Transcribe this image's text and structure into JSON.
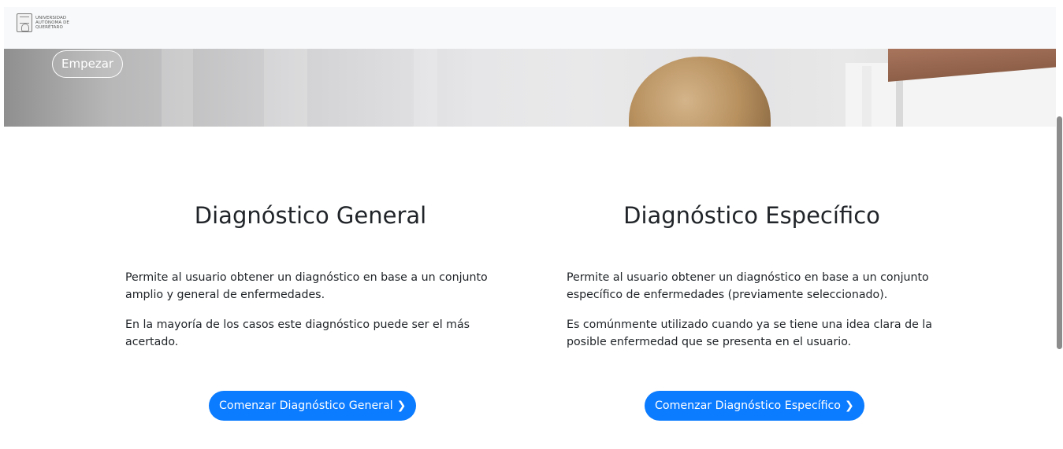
{
  "header": {
    "logo_lines": [
      "UNIVERSIDAD",
      "AUTÓNOMA DE",
      "QUERÉTARO"
    ]
  },
  "hero": {
    "start_label": "Empezar"
  },
  "general": {
    "title": "Diagnóstico General",
    "p1": "Permite al usuario obtener un diagnóstico en base a un conjunto amplio y general de enfermedades.",
    "p2": "En la mayoría de los casos este diagnóstico puede ser el más acertado.",
    "button_label": "Comenzar Diagnóstico General"
  },
  "specific": {
    "title": "Diagnóstico Específico",
    "p1": "Permite al usuario obtener un diagnóstico en base a un conjunto específico de enfermedades (previamente seleccionado).",
    "p2": "Es comúnmente utilizado cuando ya se tiene una idea clara de la posible enfermedad que se presenta en el usuario.",
    "button_label": "Comenzar Diagnóstico Específico"
  },
  "icons": {
    "chevron": "chevron-right-icon"
  },
  "colors": {
    "primary": "#0b7bff",
    "topbar": "#f8f9fa"
  }
}
